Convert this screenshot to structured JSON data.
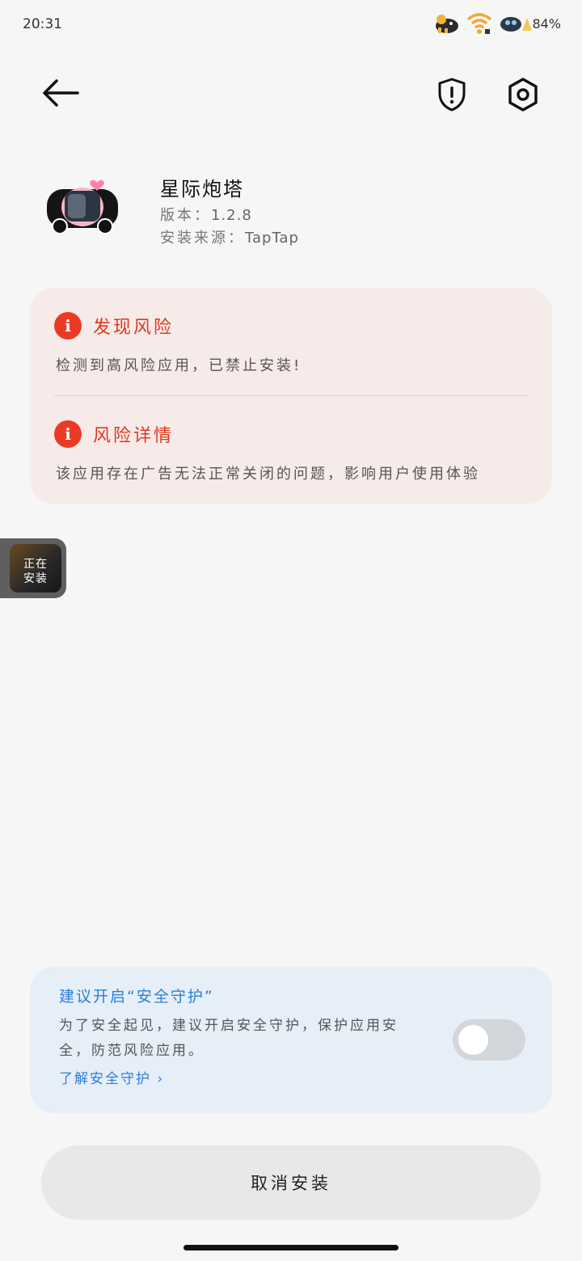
{
  "status_bar": {
    "time": "20:31",
    "battery": "84%",
    "icons": [
      "weather-character-icon",
      "wifi-icon",
      "signal-character-icon"
    ]
  },
  "toolbar": {
    "back_icon": "arrow-left-icon",
    "security_icon": "shield-alert-icon",
    "settings_icon": "hexagon-settings-icon"
  },
  "app": {
    "name": "星际炮塔",
    "version_label": "版本：",
    "version": "1.2.8",
    "source_label": "安装来源：",
    "source": "TapTap"
  },
  "risk": {
    "found_title": "发现风险",
    "found_text": "检测到高风险应用，已禁止安装!",
    "detail_title": "风险详情",
    "detail_text": "该应用存在广告无法正常关闭的问题，影响用户使用体验",
    "accent_color": "#ea3a26"
  },
  "floating": {
    "label_line1": "正在",
    "label_line2": "安装"
  },
  "protection": {
    "title": "建议开启“安全守护”",
    "description": "为了安全起见，建议开启安全守护，保护应用安全，防范风险应用。",
    "link": "了解安全守护",
    "link_chevron": "›",
    "enabled": false,
    "accent_color": "#2a7fd8"
  },
  "actions": {
    "cancel_label": "取消安装"
  }
}
